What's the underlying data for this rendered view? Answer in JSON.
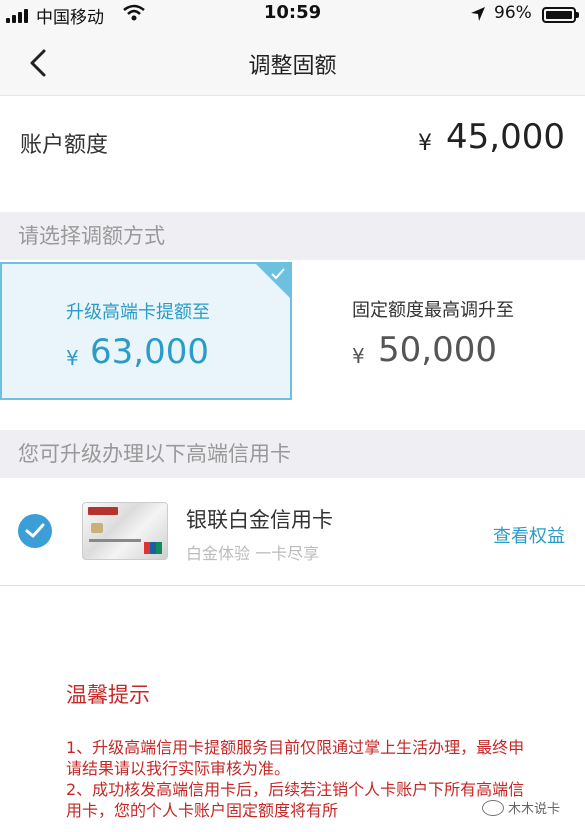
{
  "status_bar": {
    "carrier": "中国移动",
    "time": "10:59",
    "battery": "96%"
  },
  "nav": {
    "title": "调整固额"
  },
  "account": {
    "label": "账户额度",
    "currency": "¥",
    "amount": "45,000"
  },
  "adjust_section": {
    "heading": "请选择调额方式",
    "options": [
      {
        "label": "升级高端卡提额至",
        "currency": "¥",
        "amount": "63,000",
        "selected": true
      },
      {
        "label": "固定额度最高调升至",
        "currency": "¥",
        "amount": "50,000",
        "selected": false
      }
    ]
  },
  "card_section": {
    "heading": "您可升级办理以下高端信用卡",
    "card_name": "银联白金信用卡",
    "card_subtitle": "白金体验 一卡尽享",
    "benefit_link": "查看权益"
  },
  "tips": {
    "title": "温馨提示",
    "items": [
      "1、升级高端信用卡提额服务目前仅限通过掌上生活办理，最终申请结果请以我行实际审核为准。",
      "2、成功核发高端信用卡后，后续若注销个人卡账户下所有高端信用卡，您的个人卡账户固定额度将有所"
    ]
  },
  "watermark": "木木说卡",
  "colors": {
    "accent": "#2b9cc8",
    "selected_border": "#6cc0e0",
    "selected_bg": "#e9f5fb",
    "tip_red": "#c62828",
    "section_bg": "#efeff3"
  },
  "icons": [
    "signal-icon",
    "wifi-icon",
    "location-icon",
    "battery-icon",
    "back-chevron-icon",
    "checkmark-icon",
    "card-image"
  ]
}
